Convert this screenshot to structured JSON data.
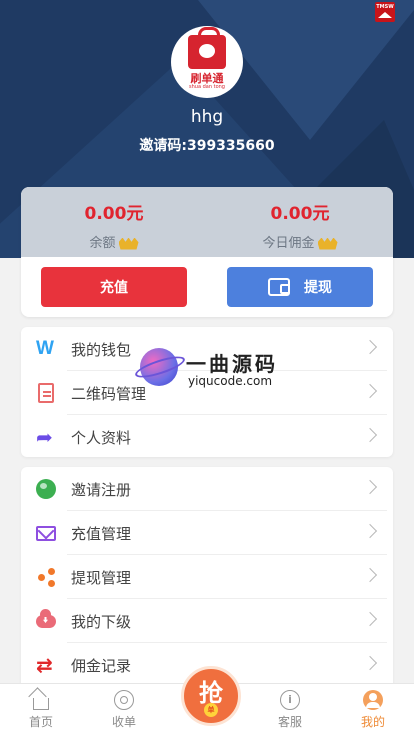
{
  "profile": {
    "username": "hhg",
    "invite_code": "邀请码:399335660",
    "avatar_logo_text": "刷单通",
    "avatar_logo_sub": "shua dan tong"
  },
  "wallet": {
    "balance_amount": "0.00元",
    "balance_label": "余额",
    "commission_amount": "0.00元",
    "commission_label": "今日佣金",
    "recharge_button": "充值",
    "withdraw_button": "提现"
  },
  "menu_group_1": [
    {
      "label": "我的钱包",
      "icon": "wallet-icon"
    },
    {
      "label": "二维码管理",
      "icon": "document-icon"
    },
    {
      "label": "个人资料",
      "icon": "share-arrow-icon"
    }
  ],
  "menu_group_2": [
    {
      "label": "邀请注册",
      "icon": "globe-icon"
    },
    {
      "label": "充值管理",
      "icon": "mail-icon"
    },
    {
      "label": "提现管理",
      "icon": "share-node-icon"
    },
    {
      "label": "我的下级",
      "icon": "cloud-download-icon"
    },
    {
      "label": "佣金记录",
      "icon": "swap-arrows-icon"
    }
  ],
  "watermark": {
    "title": "一曲源码",
    "url": "yiqucode.com"
  },
  "corner_badge": "TMSW",
  "tabbar": {
    "home": "首页",
    "orders": "收单",
    "grab": "抢",
    "grab_sub": "单",
    "service": "客服",
    "service_glyph": "i",
    "me": "我的"
  },
  "colors": {
    "header_bg": "#1f3a63",
    "accent_red": "#e8333c",
    "accent_blue": "#4d80dd",
    "active_tab": "#ee8a36"
  }
}
